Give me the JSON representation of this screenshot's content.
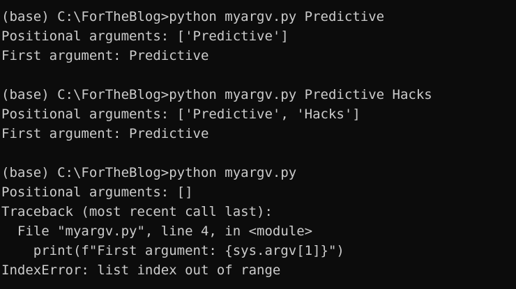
{
  "terminal": {
    "colors": {
      "background": "#0c0c0c",
      "foreground": "#cccccc"
    },
    "lines": [
      "(base) C:\\ForTheBlog>python myargv.py Predictive",
      "Positional arguments: ['Predictive']",
      "First argument: Predictive",
      "",
      "(base) C:\\ForTheBlog>python myargv.py Predictive Hacks",
      "Positional arguments: ['Predictive', 'Hacks']",
      "First argument: Predictive",
      "",
      "(base) C:\\ForTheBlog>python myargv.py",
      "Positional arguments: []",
      "Traceback (most recent call last):",
      "  File \"myargv.py\", line 4, in <module>",
      "    print(f\"First argument: {sys.argv[1]}\")",
      "IndexError: list index out of range"
    ]
  }
}
